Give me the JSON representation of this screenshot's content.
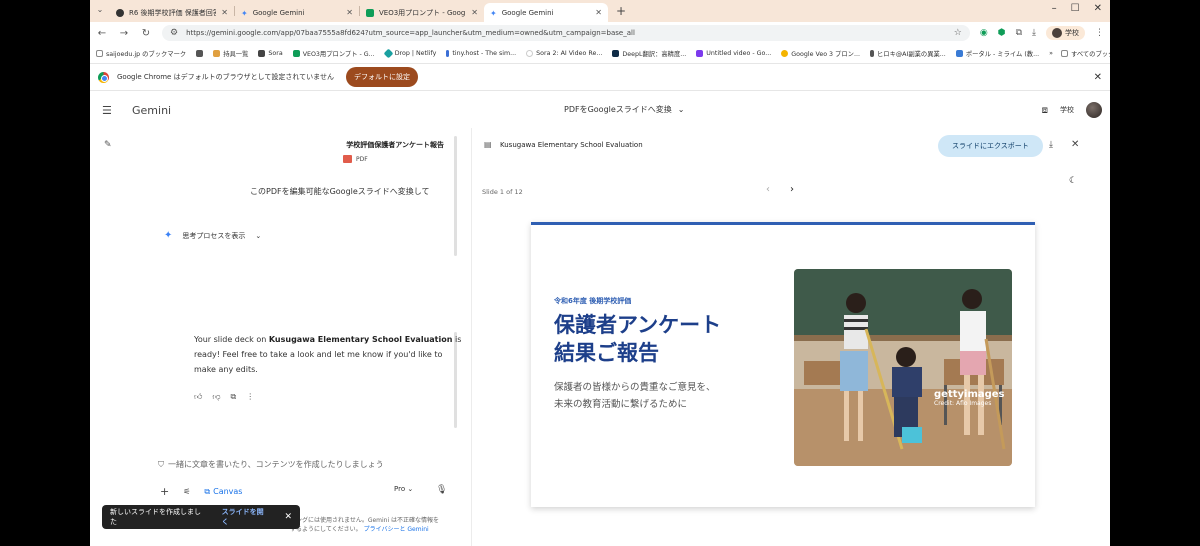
{
  "browser": {
    "tabs": [
      {
        "title": "R6 後期学校評価 保護者回答",
        "icon_color": "#333333",
        "active": false
      },
      {
        "title": "Google Gemini",
        "icon_color": "#4285f4",
        "active": false
      },
      {
        "title": "VEO3用プロンプト - Google スプレ",
        "icon_color": "#0f9d58",
        "active": false
      },
      {
        "title": "Google Gemini",
        "icon_color": "#4285f4",
        "active": true
      }
    ],
    "new_tab": "+",
    "url": "https://gemini.google.com/app/07baa7555a8fd624?utm_source=app_launcher&utm_medium=owned&utm_campaign=base_all",
    "profile_label": "学校",
    "bookmarks": [
      {
        "label": "saijoedu.jp のブックマーク",
        "color": "#888888"
      },
      {
        "label": "",
        "color": "#555555"
      },
      {
        "label": "持具一覧",
        "color": "#e0a040"
      },
      {
        "label": "Sora",
        "color": "#444444"
      },
      {
        "label": "VEO3用プロンプト - G...",
        "color": "#0f9d58"
      },
      {
        "label": "Drop | Netlify",
        "color": "#1aa0a0"
      },
      {
        "label": "tiny.host - The sim...",
        "color": "#3b6fd6"
      },
      {
        "label": "Sora 2: AI Video Re...",
        "color": "#cccccc"
      },
      {
        "label": "DeepL翻訳：高精度...",
        "color": "#0f2b46"
      },
      {
        "label": "Untitled video - Go...",
        "color": "#7c3aed"
      },
      {
        "label": "Google Veo 3 プロン...",
        "color": "#f4b400"
      },
      {
        "label": "ヒロキ@AI副業の異業...",
        "color": "#555555"
      },
      {
        "label": "ポータル - ミライム (教...",
        "color": "#3a7bd5"
      }
    ],
    "bookmarks_more": "»",
    "all_bookmarks": "すべてのブックマーク",
    "infobar_text": "Google Chrome はデフォルトのブラウザとして設定されていません",
    "infobar_button": "デフォルトに設定"
  },
  "gemini": {
    "logo": "Gemini",
    "conversation_title": "PDFをGoogleスライドへ変換",
    "profile_label": "学校",
    "chat": {
      "file_title": "学校評価保護者アンケート報告",
      "file_type": "PDF",
      "user_message": "このPDFを編集可能なGoogleスライドへ変換して",
      "thinking_label": "思考プロセスを表示",
      "response_prefix": "Your slide deck on ",
      "response_bold": "Kusugawa Elementary School Evaluation",
      "response_suffix": " is ready! Feel free to take a look and let me know if you'd like to make any edits.",
      "prompt_placeholder": "一緒に文章を書いたり、コンテンツを作成したりしましょう",
      "canvas_label": "Canvas",
      "model_label": "Pro",
      "disclaimer": "ニングには使用されません。Gemini は不正確な情報を",
      "disclaimer2": "するようにしてください。",
      "privacy_link": "プライバシーと Gemini"
    },
    "toast": {
      "message": "新しいスライドを作成しました",
      "action": "スライドを開く",
      "close": "✕"
    },
    "canvas": {
      "doc_title": "Kusugawa Elementary School Evaluation",
      "export_label": "スライドにエクスポート",
      "slide_counter": "Slide 1 of 12",
      "slide": {
        "kicker": "令和6年度 後期学校評価",
        "title_line1": "保護者アンケート",
        "title_line2": "結果ご報告",
        "subtitle_line1": "保護者の皆様からの貴重なご意見を、",
        "subtitle_line2": "未来の教育活動に繋げるために",
        "photo_watermark": "gettyimages",
        "photo_credit": "Credit: Aflo Images"
      }
    }
  }
}
